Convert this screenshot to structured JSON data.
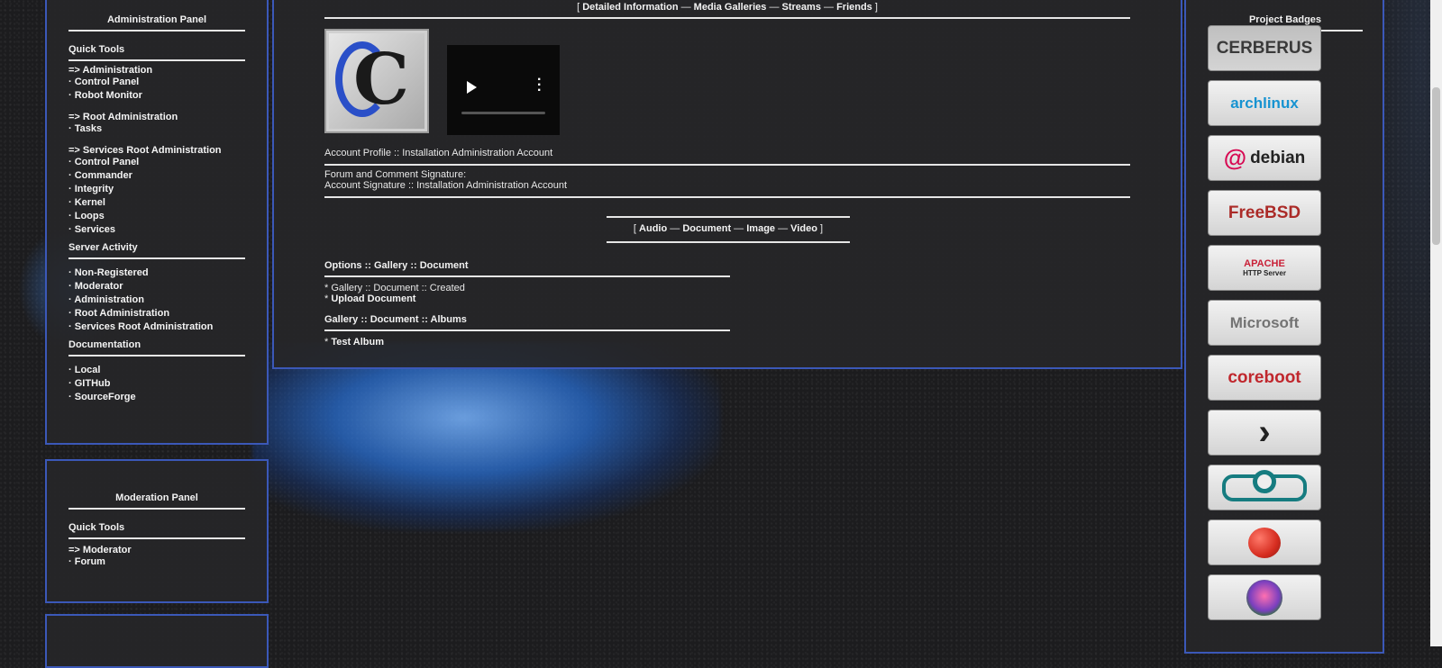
{
  "admin_panel": {
    "title": "Administration Panel",
    "quick_tools": {
      "heading": "Quick Tools",
      "groups": [
        {
          "header": "=> Administration",
          "items": [
            "Control Panel",
            "Robot Monitor"
          ]
        },
        {
          "header": "=> Root Administration",
          "items": [
            "Tasks"
          ]
        },
        {
          "header": "=> Services Root Administration",
          "items": [
            "Control Panel",
            "Commander",
            "Integrity",
            "Kernel",
            "Loops",
            "Services"
          ]
        }
      ]
    },
    "server_activity": {
      "heading": "Server Activity",
      "items": [
        "Non-Registered",
        "Moderator",
        "Administration",
        "Root Administration",
        "Services Root Administration"
      ]
    },
    "documentation": {
      "heading": "Documentation",
      "items": [
        "Local",
        "GITHub",
        "SourceForge"
      ]
    }
  },
  "moderation_panel": {
    "title": "Moderation Panel",
    "quick_tools": {
      "heading": "Quick Tools",
      "header": "=> Moderator",
      "items": [
        "Forum"
      ]
    }
  },
  "center": {
    "top_nav": {
      "open": "[",
      "close": "]",
      "sep": "—",
      "items": [
        "Detailed Information",
        "Media Galleries",
        "Streams",
        "Friends"
      ]
    },
    "account_profile": "Account Profile :: Installation Administration Account",
    "signature_label": "Forum and Comment Signature:",
    "signature_value": "Account Signature :: Installation Administration Account",
    "media_tabs": {
      "open": "[",
      "close": "]",
      "sep": "—",
      "items": [
        "Audio",
        "Document",
        "Image",
        "Video"
      ]
    },
    "options_heading": "Options :: Gallery :: Document",
    "options_items": [
      {
        "prefix": "* ",
        "text": "Gallery :: Document :: Created",
        "link": false
      },
      {
        "prefix": "* ",
        "text": "Upload Document",
        "link": true
      }
    ],
    "albums_heading": "Gallery :: Document :: Albums",
    "albums_items": [
      {
        "prefix": "* ",
        "text": "Test Album"
      }
    ],
    "logo_letter": "C"
  },
  "badges": {
    "title": "Project Badges",
    "items": [
      {
        "name": "cerberus-badge",
        "label": "CERBERUS",
        "color": "#3a3a3a",
        "bg": "#bfbfbf"
      },
      {
        "name": "archlinux-badge",
        "label": "archlinux",
        "color": "#1793d1",
        "bg": "#f2f2f2"
      },
      {
        "name": "debian-badge",
        "label": "debian",
        "color": "#222222",
        "bg": "#f2f2f2",
        "accent": "#d70a53"
      },
      {
        "name": "freebsd-badge",
        "label": "FreeBSD",
        "color": "#ab2b28",
        "bg": "#f2f2f2"
      },
      {
        "name": "apache-badge",
        "label": "APACHE",
        "sublabel": "HTTP Server",
        "color": "#c92037",
        "bg": "#f2f2f2"
      },
      {
        "name": "microsoft-badge",
        "label": "Microsoft",
        "color": "#737373",
        "bg": "#f2f2f2"
      },
      {
        "name": "coreboot-badge",
        "label": "coreboot",
        "color": "#c0272d",
        "bg": "#f2f2f2"
      },
      {
        "name": "terminal-arrow-badge",
        "label": "",
        "color": "#222222",
        "bg": "#f2f2f2"
      },
      {
        "name": "lineage-badge",
        "label": "",
        "color": "#167c80",
        "bg": "#f2f2f2"
      },
      {
        "name": "tomato-badge",
        "label": "",
        "color": "#d62d20",
        "bg": "#f2f2f2"
      },
      {
        "name": "lotus-badge",
        "label": "",
        "color": "#7a3fbf",
        "bg": "#f2f2f2"
      }
    ]
  }
}
